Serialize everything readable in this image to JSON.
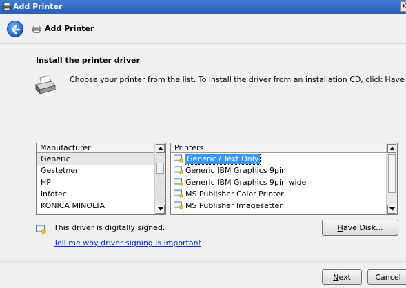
{
  "window": {
    "title": "Add Printer",
    "close_label": "X"
  },
  "header": {
    "title": "Add Printer"
  },
  "content": {
    "heading": "Install the printer driver",
    "description": "Choose your printer from the list. To install the driver from an installation CD, click Have Disk."
  },
  "manufacturer_list": {
    "header": "Manufacturer",
    "items": [
      "Generic",
      "Gestetner",
      "HP",
      "infotec",
      "KONICA MINOLTA"
    ],
    "selected": "Generic"
  },
  "printer_list": {
    "header": "Printers",
    "items": [
      "Generic / Text Only",
      "Generic IBM Graphics 9pin",
      "Generic IBM Graphics 9pin wide",
      "MS Publisher Color Printer",
      "MS Publisher Imagesetter"
    ],
    "selected": "Generic / Text Only"
  },
  "signing": {
    "status": "This driver is digitally signed.",
    "link": "Tell me why driver signing is important"
  },
  "buttons": {
    "have_disk_accel": "H",
    "have_disk_rest": "ave Disk...",
    "next_accel": "N",
    "next_rest": "ext",
    "cancel": "Cancel"
  },
  "icons": {
    "window": "printer-icon",
    "back": "back-arrow-icon",
    "header": "printer-icon",
    "driver": "printer-install-icon",
    "printer_item": "printer-item-icon",
    "signed": "signed-driver-icon"
  }
}
